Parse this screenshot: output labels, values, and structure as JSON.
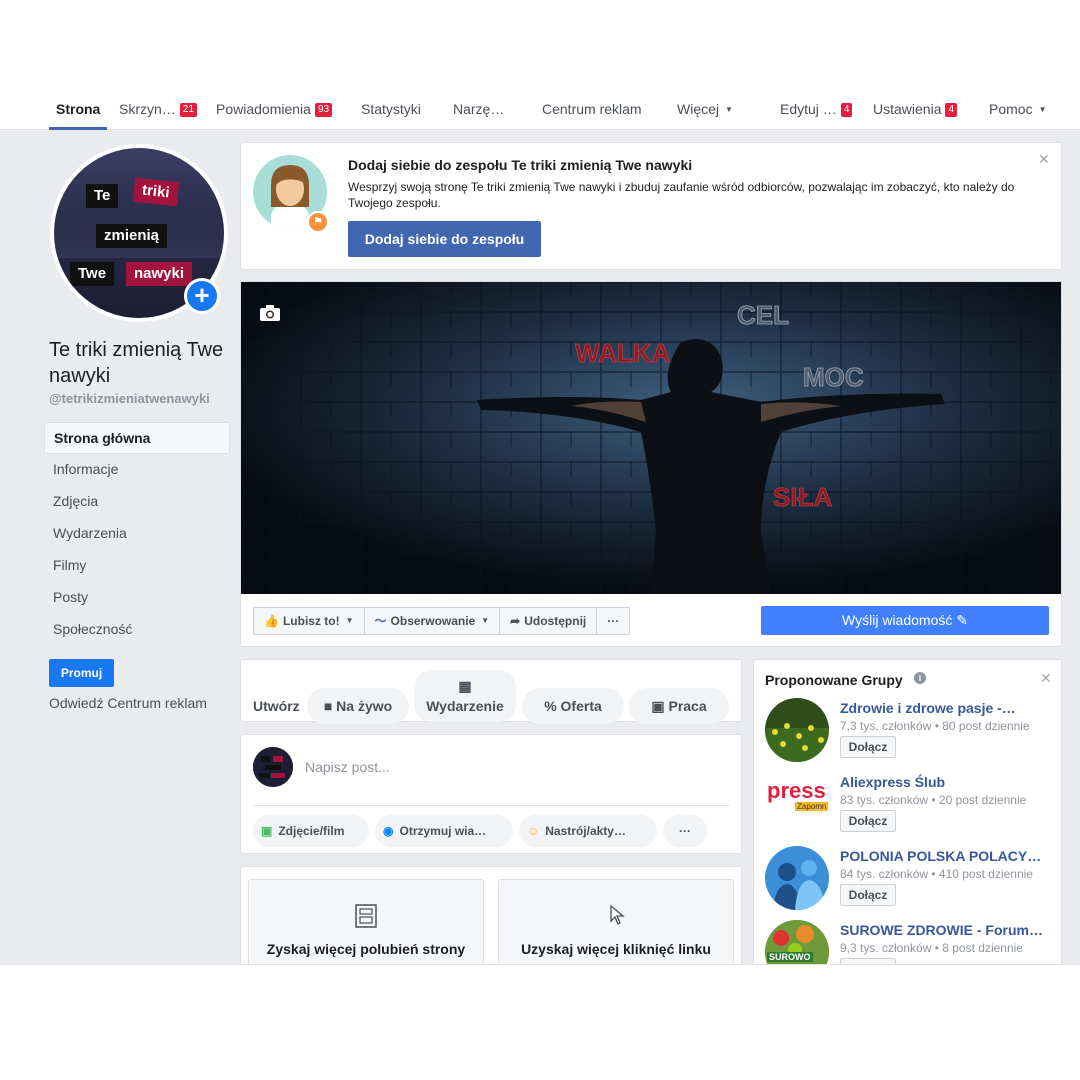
{
  "nav": {
    "tabs": [
      {
        "label": "Strona",
        "badge": ""
      },
      {
        "label": "Skrzyn…",
        "badge": "21"
      },
      {
        "label": "Powiadomienia",
        "badge": "93"
      },
      {
        "label": "Statystyki",
        "badge": ""
      },
      {
        "label": "Narzę…",
        "badge": ""
      },
      {
        "label": "Centrum reklam",
        "badge": ""
      },
      {
        "label": "Więcej",
        "badge": ""
      },
      {
        "label": "Edytuj …",
        "badge": "4"
      },
      {
        "label": "Ustawienia",
        "badge": "4"
      },
      {
        "label": "Pomoc",
        "badge": ""
      }
    ]
  },
  "profile": {
    "name": "Te triki zmienią Twe nawyki",
    "handle": "@tetrikizmieniatwenawyki",
    "avatar_words": [
      "Te",
      "triki",
      "zmienią",
      "Twe",
      "nawyki"
    ]
  },
  "leftnav": {
    "items": [
      "Strona główna",
      "Informacje",
      "Zdjęcia",
      "Wydarzenia",
      "Filmy",
      "Posty",
      "Społeczność"
    ]
  },
  "promote": {
    "button": "Promuj",
    "link": "Odwiedź Centrum reklam"
  },
  "team_card": {
    "title": "Dodaj siebie do zespołu Te triki zmienią Twe nawyki",
    "description": "Wesprzyj swoją stronę Te triki zmienią Twe nawyki i zbuduj zaufanie wśród odbiorców, pozwalając im zobaczyć, kto należy do Twojego zespołu.",
    "button": "Dodaj siebie do zespołu"
  },
  "cover": {
    "words": [
      "WALKA",
      "CEL",
      "MOC",
      "SIŁA"
    ]
  },
  "actions": {
    "like": "Lubisz to!",
    "follow": "Obserwowanie",
    "share": "Udostępnij",
    "more": "···",
    "message": "Wyślij wiadomość"
  },
  "create": {
    "label": "Utwórz",
    "options": [
      "Na żywo",
      "Wydarzenie",
      "Oferta",
      "Praca"
    ]
  },
  "composer": {
    "placeholder": "Napisz post...",
    "options": [
      "Zdjęcie/film",
      "Otrzymuj wia…",
      "Nastrój/akty…"
    ],
    "more": "···"
  },
  "promo_boxes": [
    "Zyskaj więcej polubień strony",
    "Uzyskaj więcej kliknięć linku"
  ],
  "groups": {
    "title": "Proponowane Grupy",
    "join_label": "Dołącz",
    "items": [
      {
        "name": "Zdrowie i zdrowe pasje -…",
        "meta": "7,3 tys. członków • 80 post dziennie"
      },
      {
        "name": "Aliexpress Ślub",
        "meta": "83 tys. członków • 20 post dziennie",
        "img_text": "press",
        "img_sub": "Zapomn"
      },
      {
        "name": "POLONIA POLSKA POLACY…",
        "meta": "84 tys. członków • 410 post dziennie"
      },
      {
        "name": "SUROWE ZDROWIE - Forum…",
        "meta": "9,3 tys. członków • 8 post dziennie",
        "img_text": "SUROWO"
      }
    ]
  },
  "colors": {
    "accent": "#4267b2",
    "button_blue": "#1877f2",
    "message_blue": "#4080ff",
    "badge_red": "#e41e3f",
    "page_bg": "#e9ebee",
    "avatar_label_red": "#a4133c"
  }
}
